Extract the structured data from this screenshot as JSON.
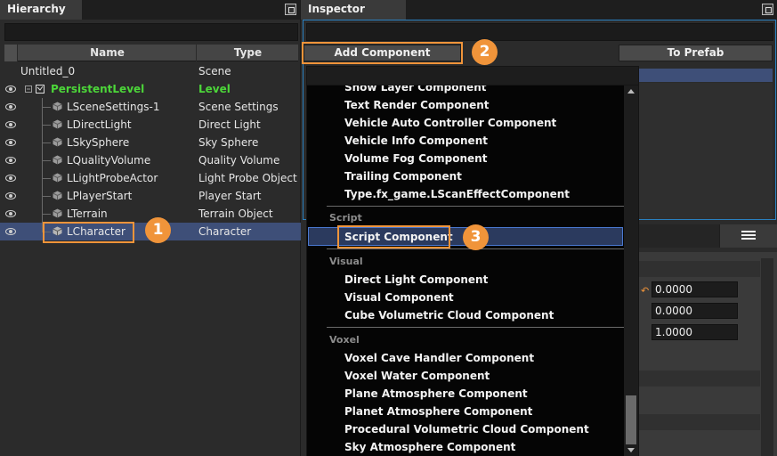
{
  "hierarchy": {
    "title": "Hierarchy",
    "columns": {
      "name": "Name",
      "type": "Type"
    },
    "root": {
      "name": "Untitled_0",
      "type": "Scene"
    },
    "level": {
      "name": "PersistentLevel",
      "type": "Level"
    },
    "items": [
      {
        "name": "LSceneSettings-1",
        "type": "Scene Settings"
      },
      {
        "name": "LDirectLight",
        "type": "Direct Light"
      },
      {
        "name": "LSkySphere",
        "type": "Sky Sphere"
      },
      {
        "name": "LQualityVolume",
        "type": "Quality Volume"
      },
      {
        "name": "LLightProbeActor",
        "type": "Light Probe Object"
      },
      {
        "name": "LPlayerStart",
        "type": "Player Start"
      },
      {
        "name": "LTerrain",
        "type": "Terrain Object"
      },
      {
        "name": "LCharacter",
        "type": "Character"
      }
    ]
  },
  "inspector": {
    "title": "Inspector",
    "add_component": "Add Component",
    "to_prefab": "To Prefab",
    "fields": [
      "0.0000",
      "0.0000",
      "1.0000"
    ]
  },
  "dropdown": {
    "partial_item": "Show Layer Component",
    "group_top": [
      "Text Render Component",
      "Vehicle Auto Controller Component",
      "Vehicle Info Component",
      "Volume Fog Component",
      "Trailing Component",
      "Type.fx_game.LScanEffectComponent"
    ],
    "cat_script": "Script",
    "script_items": [
      "Script Component"
    ],
    "cat_visual": "Visual",
    "visual_items": [
      "Direct Light Component",
      "Visual Component",
      "Cube Volumetric Cloud Component"
    ],
    "cat_voxel": "Voxel",
    "voxel_items": [
      "Voxel Cave Handler Component",
      "Voxel Water Component",
      "Plane Atmosphere Component",
      "Planet Atmosphere Component",
      "Procedural Volumetric Cloud Component",
      "Sky Atmosphere Component"
    ]
  },
  "badges": {
    "b1": "1",
    "b2": "2",
    "b3": "3"
  },
  "colors": {
    "accent": "#f0943a",
    "selection": "#3e4f78",
    "level": "#4cd639"
  }
}
